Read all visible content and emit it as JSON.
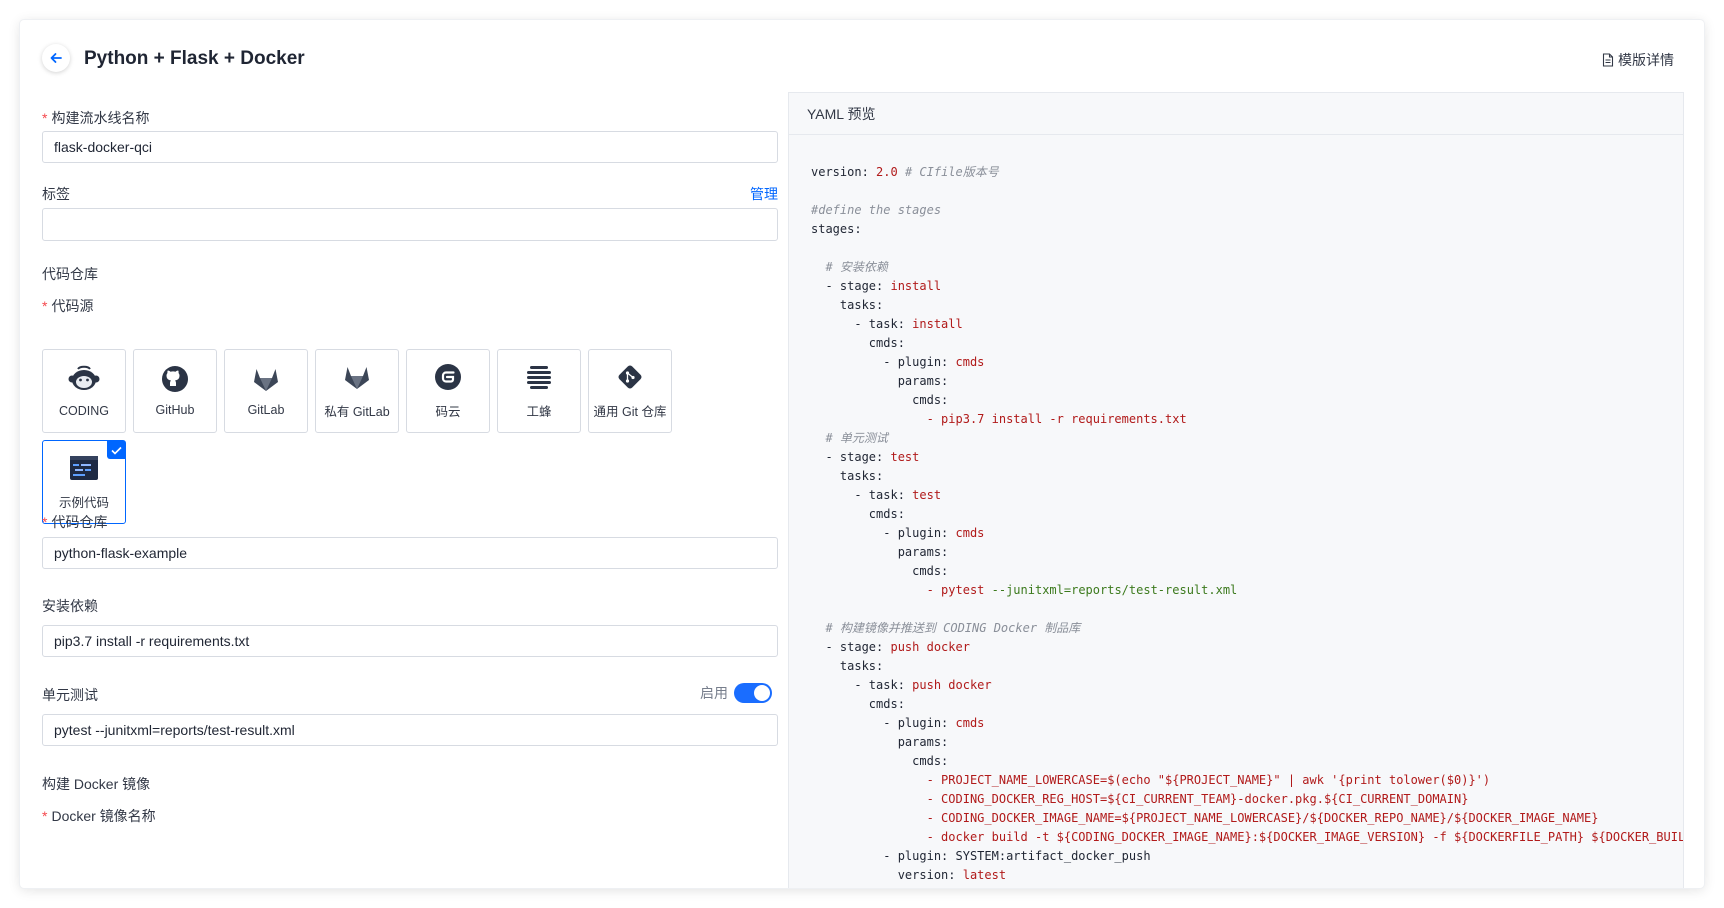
{
  "header": {
    "title": "Python + Flask + Docker",
    "template_link": "模版详情"
  },
  "form": {
    "pipeline_name": {
      "label": "构建流水线名称",
      "value": "flask-docker-qci"
    },
    "tags": {
      "label": "标签",
      "manage": "管理",
      "value": ""
    },
    "repo_section": "代码仓库",
    "source": {
      "label": "代码源",
      "options": [
        "CODING",
        "GitHub",
        "GitLab",
        "私有 GitLab",
        "码云",
        "工蜂",
        "通用 Git 仓库",
        "示例代码"
      ],
      "selected": "示例代码"
    },
    "repository": {
      "label": "代码仓库",
      "value": "python-flask-example"
    },
    "install": {
      "label": "安装依赖",
      "value": "pip3.7 install -r requirements.txt"
    },
    "unit_test": {
      "label": "单元测试",
      "toggle_label": "启用",
      "enabled": true,
      "value": "pytest --junitxml=reports/test-result.xml"
    },
    "docker_section": "构建 Docker 镜像",
    "docker_image_name": {
      "label": "Docker 镜像名称"
    }
  },
  "yaml": {
    "title": "YAML 预览",
    "lines": [
      [
        [
          "k",
          "version: "
        ],
        [
          "v",
          "2.0"
        ],
        [
          "c",
          " # CIfile版本号"
        ]
      ],
      [],
      [
        [
          "c",
          "#define the stages"
        ]
      ],
      [
        [
          "k",
          "stages:"
        ]
      ],
      [],
      [
        [
          "c",
          "  # 安装依赖"
        ]
      ],
      [
        [
          "k",
          "  - stage: "
        ],
        [
          "v",
          "install"
        ]
      ],
      [
        [
          "k",
          "    tasks:"
        ]
      ],
      [
        [
          "k",
          "      - task: "
        ],
        [
          "v",
          "install"
        ]
      ],
      [
        [
          "k",
          "        cmds:"
        ]
      ],
      [
        [
          "k",
          "          - plugin: "
        ],
        [
          "v",
          "cmds"
        ]
      ],
      [
        [
          "k",
          "            params:"
        ]
      ],
      [
        [
          "k",
          "              cmds:"
        ]
      ],
      [
        [
          "k",
          "                "
        ],
        [
          "v",
          "- pip3.7 install -r requirements.txt"
        ]
      ],
      [
        [
          "c",
          "  # 单元测试"
        ]
      ],
      [
        [
          "k",
          "  - stage: "
        ],
        [
          "v",
          "test"
        ]
      ],
      [
        [
          "k",
          "    tasks:"
        ]
      ],
      [
        [
          "k",
          "      - task: "
        ],
        [
          "v",
          "test"
        ]
      ],
      [
        [
          "k",
          "        cmds:"
        ]
      ],
      [
        [
          "k",
          "          - plugin: "
        ],
        [
          "v",
          "cmds"
        ]
      ],
      [
        [
          "k",
          "            params:"
        ]
      ],
      [
        [
          "k",
          "              cmds:"
        ]
      ],
      [
        [
          "k",
          "                "
        ],
        [
          "v",
          "- pytest "
        ],
        [
          "g",
          "--junitxml=reports/test-result.xml"
        ]
      ],
      [],
      [
        [
          "c",
          "  # 构建镜像并推送到 CODING Docker 制品库"
        ]
      ],
      [
        [
          "k",
          "  - stage: "
        ],
        [
          "v",
          "push docker"
        ]
      ],
      [
        [
          "k",
          "    tasks:"
        ]
      ],
      [
        [
          "k",
          "      - task: "
        ],
        [
          "v",
          "push docker"
        ]
      ],
      [
        [
          "k",
          "        cmds:"
        ]
      ],
      [
        [
          "k",
          "          - plugin: "
        ],
        [
          "v",
          "cmds"
        ]
      ],
      [
        [
          "k",
          "            params:"
        ]
      ],
      [
        [
          "k",
          "              cmds:"
        ]
      ],
      [
        [
          "k",
          "                "
        ],
        [
          "v",
          "- PROJECT_NAME_LOWERCASE=$(echo \"${PROJECT_NAME}\" | awk '{print tolower($0)}')"
        ]
      ],
      [
        [
          "k",
          "                "
        ],
        [
          "v",
          "- CODING_DOCKER_REG_HOST=${CI_CURRENT_TEAM}-docker.pkg.${CI_CURRENT_DOMAIN}"
        ]
      ],
      [
        [
          "k",
          "                "
        ],
        [
          "v",
          "- CODING_DOCKER_IMAGE_NAME=${PROJECT_NAME_LOWERCASE}/${DOCKER_REPO_NAME}/${DOCKER_IMAGE_NAME}"
        ]
      ],
      [
        [
          "k",
          "                "
        ],
        [
          "v",
          "- docker build -t ${CODING_DOCKER_IMAGE_NAME}:${DOCKER_IMAGE_VERSION} -f ${DOCKERFILE_PATH} ${DOCKER_BUIL"
        ]
      ],
      [
        [
          "k",
          "          - plugin: SYSTEM:artifact_docker_push"
        ]
      ],
      [
        [
          "k",
          "            version: "
        ],
        [
          "v",
          "latest"
        ]
      ]
    ]
  },
  "colors": {
    "accent": "#0066ff",
    "required": "#f5484d",
    "yaml_value": "#b11a1a",
    "yaml_comment": "#8a8f99"
  }
}
